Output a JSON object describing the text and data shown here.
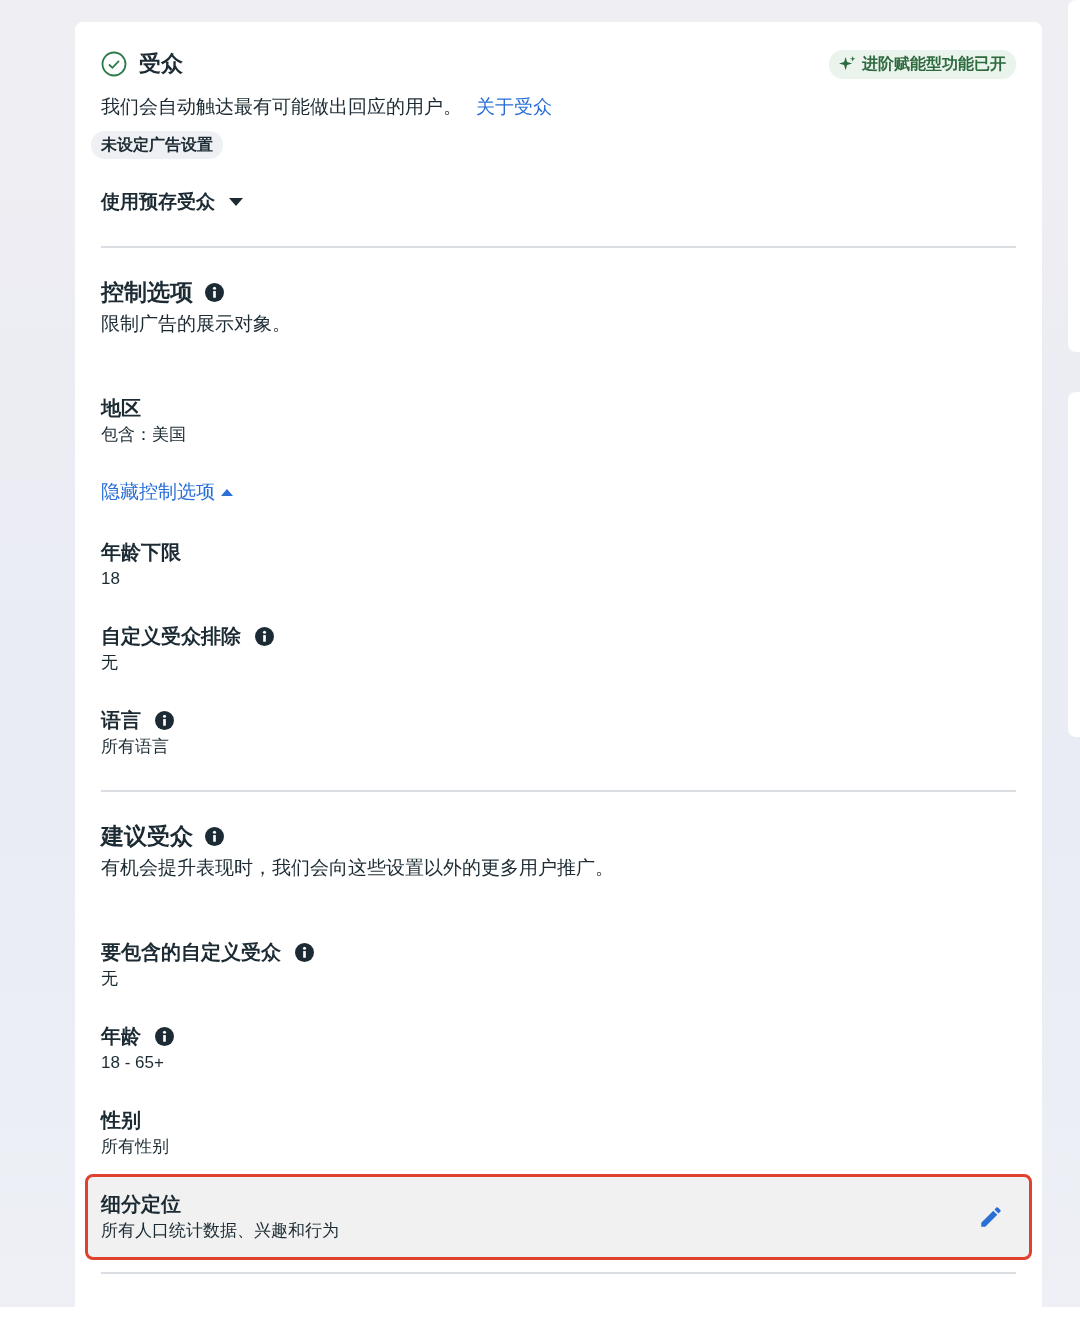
{
  "header": {
    "title": "受众",
    "complete": true,
    "badge": "进阶赋能型功能已开",
    "description": "我们会自动触达最有可能做出回应的用户。",
    "link": "关于受众",
    "tag": "未设定广告设置",
    "dropdown": "使用预存受众"
  },
  "blocks": [
    {
      "kind": "divider"
    },
    {
      "kind": "heading",
      "title": "控制选项",
      "info": true,
      "subtitle": "限制广告的展示对象。"
    },
    {
      "kind": "field",
      "title": "地区",
      "info": false,
      "value": "包含：美国"
    },
    {
      "kind": "toggle",
      "label": "隐藏控制选项",
      "expanded": true
    },
    {
      "kind": "field",
      "title": "年龄下限",
      "info": false,
      "value": "18"
    },
    {
      "kind": "field",
      "title": "自定义受众排除",
      "info": true,
      "value": "无"
    },
    {
      "kind": "field",
      "title": "语言",
      "info": true,
      "value": "所有语言"
    },
    {
      "kind": "divider"
    },
    {
      "kind": "heading",
      "title": "建议受众",
      "info": true,
      "subtitle": "有机会提升表现时，我们会向这些设置以外的更多用户推广。"
    },
    {
      "kind": "field",
      "title": "要包含的自定义受众",
      "info": true,
      "value": "无"
    },
    {
      "kind": "field",
      "title": "年龄",
      "info": true,
      "value": "18 - 65+"
    },
    {
      "kind": "field",
      "title": "性别",
      "info": false,
      "value": "所有性别"
    },
    {
      "kind": "field",
      "title": "细分定位",
      "info": false,
      "value": "所有人口统计数据、兴趣和行为",
      "editable": true,
      "highlighted": true
    },
    {
      "kind": "divider"
    }
  ]
}
